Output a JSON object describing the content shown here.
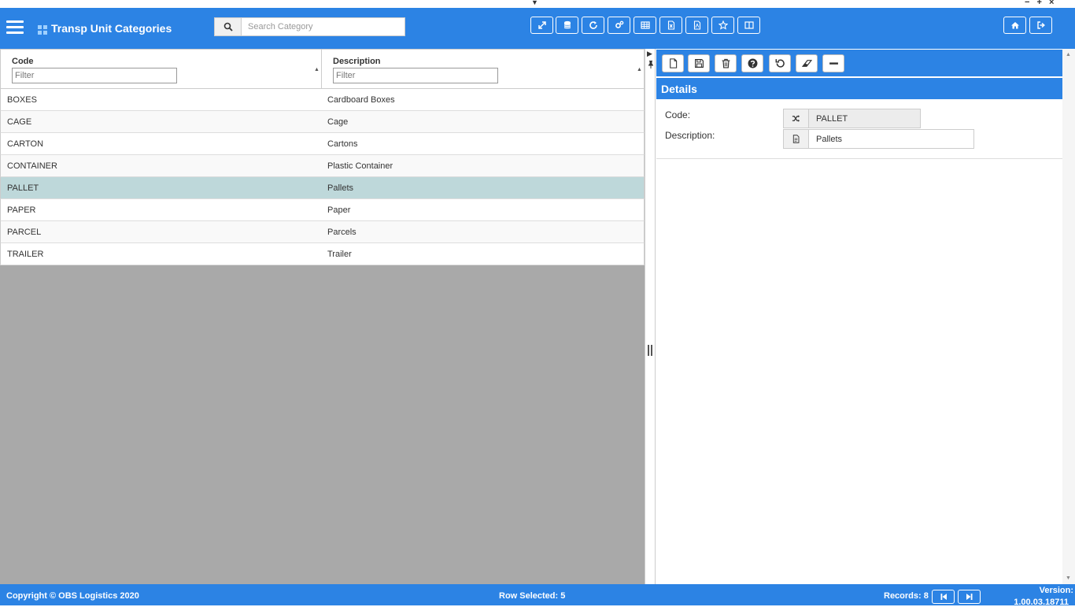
{
  "window": {
    "top_caret": "▼",
    "controls": "− + ×"
  },
  "header": {
    "title": "Transp Unit Categories",
    "search_placeholder": "Search Category",
    "toolbar_icons": [
      "expand-icon",
      "database-icon",
      "refresh-icon",
      "settings-icon",
      "table-icon",
      "export-excel-icon",
      "export-pdf-icon",
      "star-icon",
      "columns-icon"
    ],
    "right_icons": [
      "home-icon",
      "logout-icon"
    ]
  },
  "grid": {
    "columns": [
      {
        "title": "Code",
        "filter_placeholder": "Filter"
      },
      {
        "title": "Description",
        "filter_placeholder": "Filter"
      }
    ],
    "sort_caret": "▲",
    "rows": [
      {
        "code": "BOXES",
        "description": "Cardboard Boxes"
      },
      {
        "code": "CAGE",
        "description": "Cage"
      },
      {
        "code": "CARTON",
        "description": "Cartons"
      },
      {
        "code": "CONTAINER",
        "description": "Plastic Container"
      },
      {
        "code": "PALLET",
        "description": "Pallets",
        "selected": true
      },
      {
        "code": "PAPER",
        "description": "Paper"
      },
      {
        "code": "PARCEL",
        "description": "Parcels"
      },
      {
        "code": "TRAILER",
        "description": "Trailer"
      }
    ]
  },
  "splitter": {
    "collapse": "▶",
    "pin": "📌"
  },
  "detail": {
    "toolbar_icons": [
      "new-icon",
      "save-icon",
      "delete-icon",
      "help-icon",
      "undo-icon",
      "eraser-icon",
      "minus-icon"
    ],
    "title": "Details",
    "fields": [
      {
        "label": "Code:",
        "value": "PALLET",
        "icon": "shuffle-icon",
        "readonly": true
      },
      {
        "label": "Description:",
        "value": "Pallets",
        "icon": "document-icon",
        "readonly": false
      }
    ]
  },
  "footer": {
    "copyright": "Copyright © OBS Logistics 2020",
    "row_selected": "Row Selected: 5",
    "records": "Records: 8",
    "version_label": "Version:",
    "version_value": "1.00.03.18711"
  },
  "colors": {
    "primary": "#2c83e4",
    "selected_row": "#bed8da",
    "grid_empty": "#a9a9a9"
  }
}
